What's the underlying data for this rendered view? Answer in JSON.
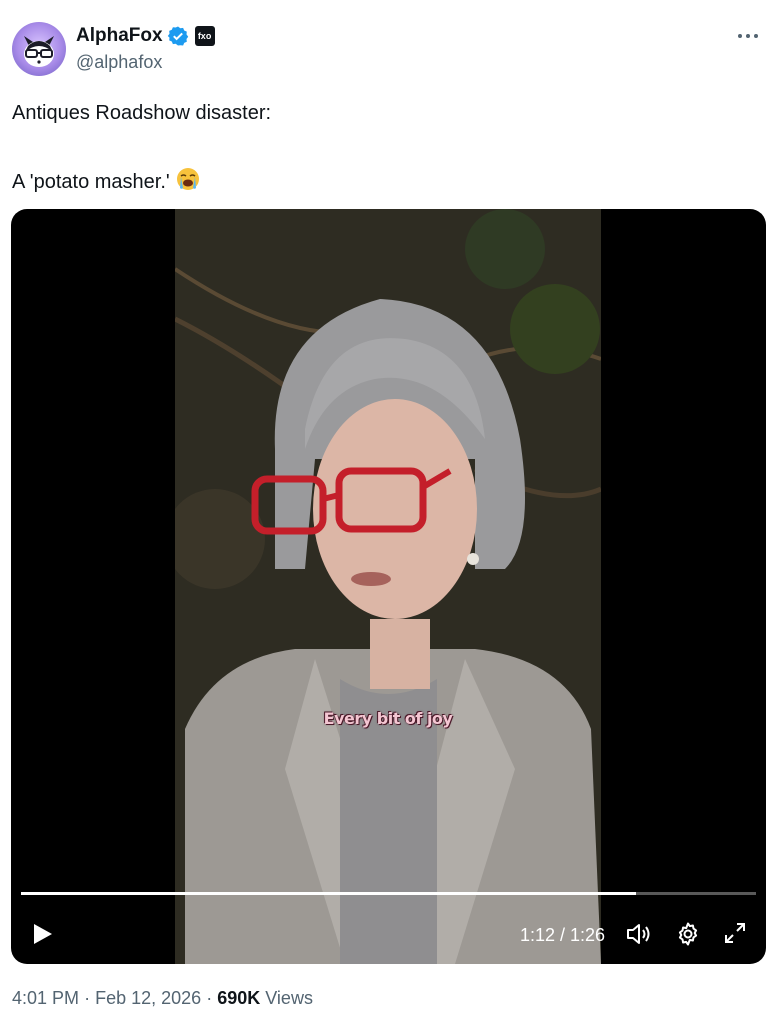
{
  "author": {
    "display_name": "AlphaFox",
    "handle": "@alphafox",
    "verified": true,
    "affiliation_badge_text": "fxo",
    "avatar_icon": "fox-with-glasses-avatar"
  },
  "more_icon": "more-horizontal-icon",
  "tweet": {
    "line1": "Antiques Roadshow disaster:",
    "line2": "A 'potato masher.'",
    "emoji": "loudly-crying-face"
  },
  "video": {
    "caption": "Every bit of joy",
    "current_time": "1:12",
    "duration": "1:26",
    "time_display": "1:12 / 1:26",
    "progress": 0.837,
    "controls": {
      "play_icon": "play-icon",
      "volume_icon": "volume-icon",
      "settings_icon": "gear-icon",
      "fullscreen_icon": "expand-icon"
    }
  },
  "meta": {
    "time": "4:01 PM",
    "separator": "·",
    "date": "Feb 12, 2026",
    "views_count": "690K",
    "views_label": "Views"
  },
  "colors": {
    "verified_blue": "#1d9bf0",
    "secondary_text": "#536471",
    "primary_text": "#0f1419",
    "caption_pink": "#f4c6d2"
  }
}
